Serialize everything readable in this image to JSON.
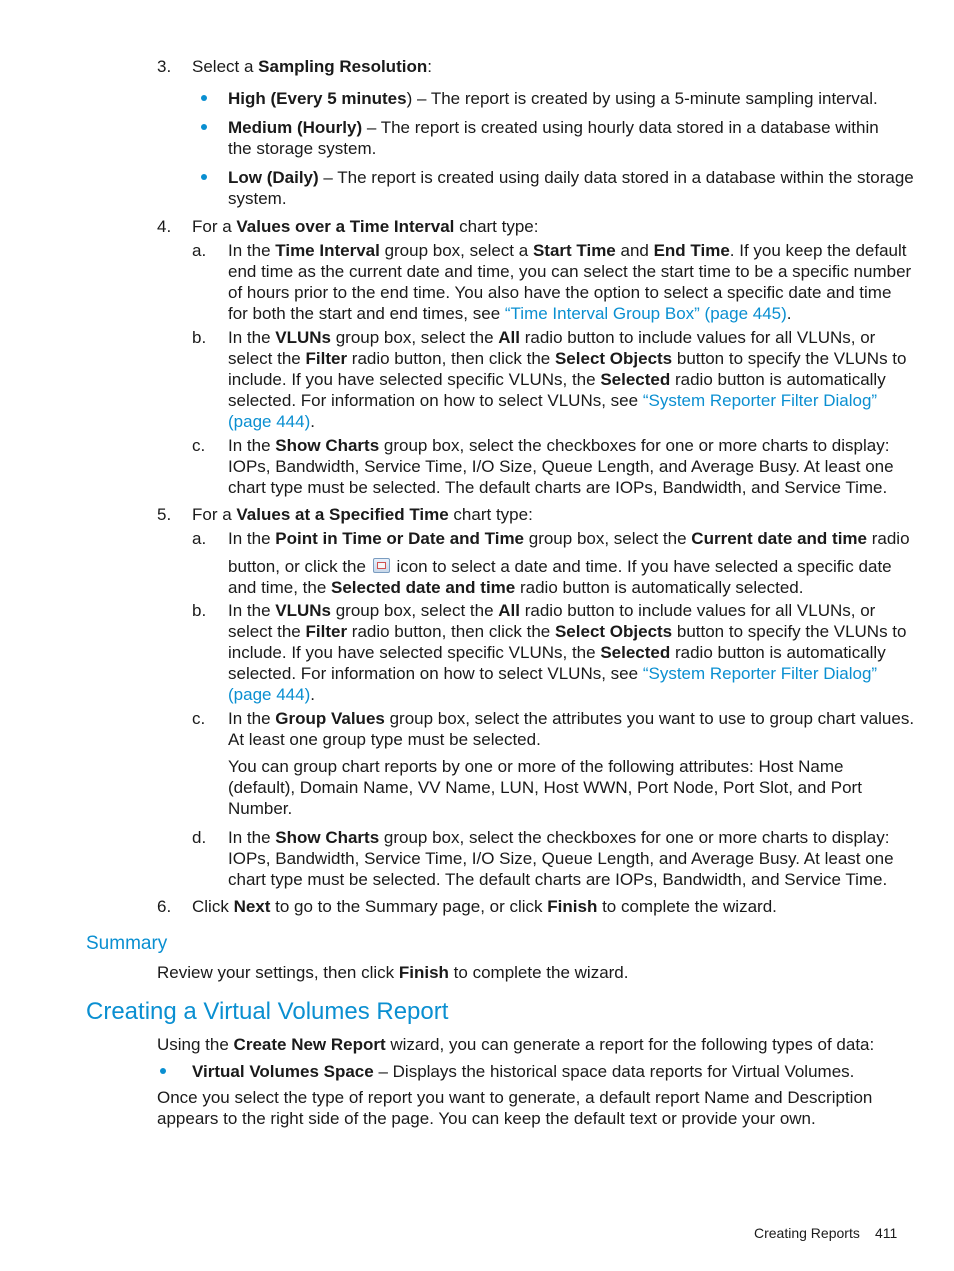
{
  "step3": {
    "num": "3.",
    "intro": "Select a ",
    "intro_bold": "Sampling Resolution",
    "intro_end": ":",
    "bullets": [
      {
        "bold": "High (Every 5 minutes",
        "rest": ") – The report is created by using a 5-minute sampling interval."
      },
      {
        "bold": "Medium (Hourly)",
        "rest": " – The report is created using hourly data stored in a database within",
        "rest2": "the storage system."
      },
      {
        "bold": "Low (Daily)",
        "rest": " – The report is created using daily data stored in a database within the storage",
        "rest2": "system."
      }
    ]
  },
  "step4": {
    "num": "4.",
    "intro": "For a ",
    "intro_bold": "Values over a Time Interval",
    "intro_end": " chart type:",
    "a": {
      "label": "a.",
      "l1_1": "In the ",
      "l1_b1": "Time Interval",
      "l1_2": " group box, select a ",
      "l1_b2": "Start Time",
      "l1_3": " and ",
      "l1_b3": "End Time",
      "l1_4": ". If you keep the default",
      "l2": "end time as the current date and time, you can select the start time to be a specific number",
      "l3": "of hours prior to the end time. You also have the option to select a specific date and time",
      "l4": "for both the start and end times, see ",
      "l4_link": "“Time Interval Group Box” (page 445)",
      "l4_end": "."
    },
    "b": {
      "label": "b.",
      "l1_1": "In the ",
      "l1_b1": "VLUNs",
      "l1_2": " group box, select the ",
      "l1_b2": "All",
      "l1_3": " radio button to include values for all VLUNs, or",
      "l2_1": "select the ",
      "l2_b1": "Filter",
      "l2_2": " radio button, then click the ",
      "l2_b2": "Select Objects",
      "l2_3": "  button to specify the VLUNs to",
      "l3_1": "include. If you have selected specific VLUNs, the ",
      "l3_b1": "Selected",
      "l3_2": " radio button is automatically",
      "l4": "selected. For information on how to select VLUNs, see ",
      "l4_link": "“System Reporter Filter Dialog”",
      "l5_link": "(page 444)",
      "l5_end": "."
    },
    "c": {
      "label": "c.",
      "l1_1": "In the ",
      "l1_b1": "Show Charts",
      "l1_2": " group box, select the checkboxes for one or more charts to display:",
      "l2": "IOPs, Bandwidth, Service Time, I/O Size, Queue Length, and Average Busy. At least one",
      "l3": "chart type must be selected. The default charts are IOPs, Bandwidth, and Service Time."
    }
  },
  "step5": {
    "num": "5.",
    "intro": "For a ",
    "intro_bold": "Values at a Specified Time",
    "intro_end": " chart type:",
    "a": {
      "label": "a.",
      "l1_1": "In the ",
      "l1_b1": "Point in Time or Date and Time",
      "l1_2": " group box, select the ",
      "l1_b2": "Current date and time",
      "l1_3": " radio",
      "l2_1": "button, or click the",
      "l2_icon": "calendar-icon",
      "l2_2": "icon to select a date and time. If you have selected a specific date",
      "l3_1": "and time, the ",
      "l3_b1": "Selected date and time",
      "l3_2": " radio button is automatically selected."
    },
    "b": {
      "label": "b.",
      "l1_1": "In the ",
      "l1_b1": "VLUNs",
      "l1_2": " group box, select the ",
      "l1_b2": "All",
      "l1_3": " radio button to include values for all VLUNs, or",
      "l2_1": "select the ",
      "l2_b1": "Filter",
      "l2_2": " radio button, then click the ",
      "l2_b2": "Select Objects",
      "l2_3": "  button to specify the VLUNs to",
      "l3_1": "include. If you have selected specific VLUNs, the ",
      "l3_b1": "Selected",
      "l3_2": " radio button is automatically",
      "l4": "selected. For information on how to select VLUNs, see ",
      "l4_link": "“System Reporter Filter Dialog”",
      "l5_link": "(page 444)",
      "l5_end": "."
    },
    "c": {
      "label": "c.",
      "l1_1": "In the ",
      "l1_b1": "Group Values",
      "l1_2": " group box, select the attributes you want to use to group chart values.",
      "l2": "At least one group type must be selected.",
      "p1": "You can group chart reports by one or more of the following attributes: Host Name",
      "p2": "(default), Domain Name, VV Name, LUN, Host WWN, Port Node, Port Slot, and Port",
      "p3": "Number."
    },
    "d": {
      "label": "d.",
      "l1_1": "In the ",
      "l1_b1": "Show Charts",
      "l1_2": " group box, select the checkboxes for one or more charts to display:",
      "l2": "IOPs, Bandwidth, Service Time, I/O Size, Queue Length, and Average Busy. At least one",
      "l3": "chart type must be selected. The default charts are IOPs, Bandwidth, and Service Time."
    }
  },
  "step6": {
    "num": "6.",
    "t1": "Click ",
    "b1": "Next",
    "t2": " to go to the Summary page, or click ",
    "b2": "Finish",
    "t3": " to complete the wizard."
  },
  "summary": {
    "heading": "Summary",
    "t1": "Review your settings, then click ",
    "b1": "Finish",
    "t2": " to complete the wizard."
  },
  "vv_section": {
    "heading": "Creating a Virtual Volumes Report",
    "p1_1": "Using the ",
    "p1_b": "Create New Report",
    "p1_2": " wizard, you can generate a report for the following types of data:",
    "bullet_bold": "Virtual Volumes Space",
    "bullet_rest": " – Displays the historical space data reports for Virtual Volumes.",
    "p2": "Once you select the type of report you want to generate, a default report Name and Description",
    "p3": "appears to the right side of the page. You can keep the default text or provide your own."
  },
  "footer": {
    "section": "Creating Reports",
    "page": "411"
  },
  "colors": {
    "accent": "#0a8fd1",
    "text": "#1a1a1a"
  }
}
